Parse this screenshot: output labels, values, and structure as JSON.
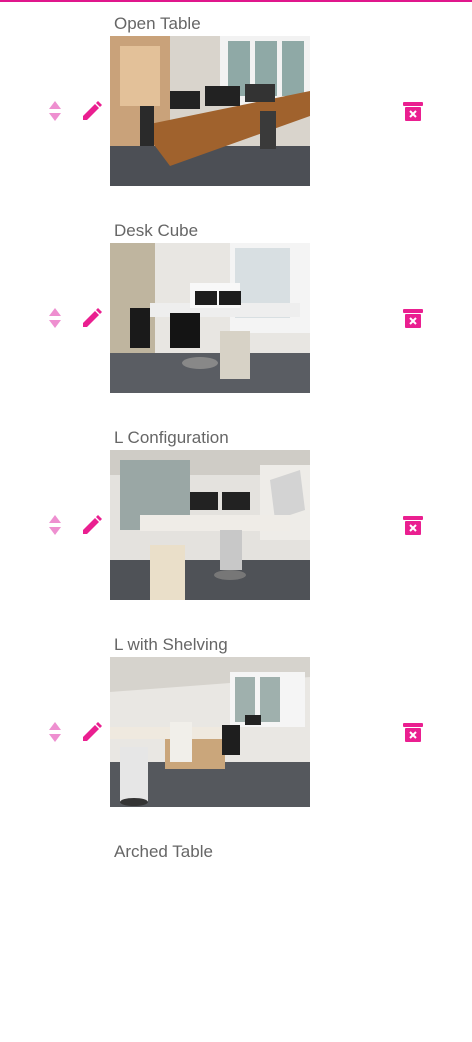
{
  "accent_color": "#ea1f90",
  "title_color": "#666666",
  "icons": {
    "sort": "sort-up-down-icon",
    "edit": "pencil-icon",
    "delete": "trash-x-icon"
  },
  "items": [
    {
      "title": "Open Table"
    },
    {
      "title": "Desk Cube"
    },
    {
      "title": "L Configuration"
    },
    {
      "title": "L with Shelving"
    },
    {
      "title": "Arched Table"
    }
  ]
}
